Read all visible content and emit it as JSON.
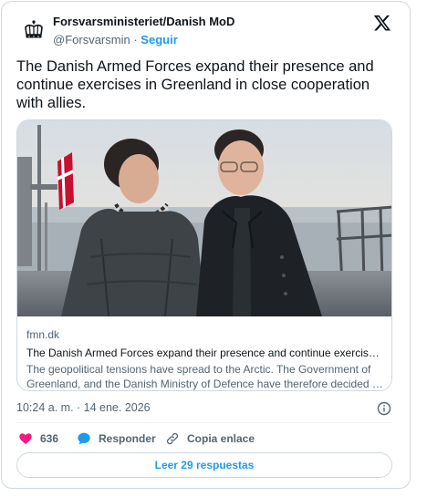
{
  "author": {
    "display_name": "Forsvarsministeriet/Danish MoD",
    "handle": "@Forsvarsmin",
    "separator": "·",
    "follow_label": "Seguir"
  },
  "tweet": {
    "text": "The Danish Armed Forces expand their presence and continue exercises in Greenland in close cooperation with allies."
  },
  "link_card": {
    "domain": "fmn.dk",
    "title": "The Danish Armed Forces expand their presence and continue exercises in Greenland in close cooperation with allies",
    "description": "The geopolitical tensions have spread to the Arctic. The Government of Greenland, and the Danish Ministry of Defence have therefore decided to expand the presence of the Danish Armed Forces."
  },
  "timestamp": "10:24 a. m. · 14 ene. 2026",
  "actions": {
    "like_count": "636",
    "reply_label": "Responder",
    "copy_label": "Copia enlace"
  },
  "read_replies_label": "Leer 29 respuestas",
  "colors": {
    "accent": "#1d9bf0",
    "like": "#f91880",
    "text_secondary": "#536471",
    "border": "#cfd9de"
  },
  "icons": [
    "crown-icon",
    "x-logo-icon",
    "info-icon",
    "heart-icon",
    "reply-bubble-icon",
    "link-icon"
  ]
}
